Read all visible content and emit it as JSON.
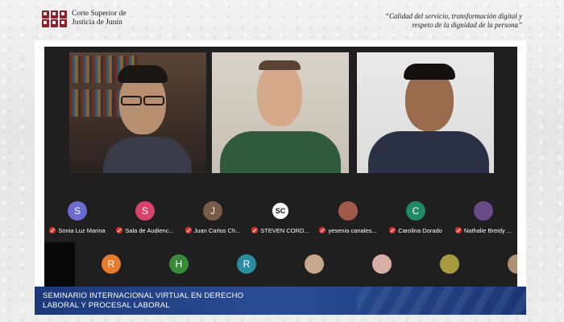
{
  "header": {
    "org_line1": "Corte Superior de",
    "org_line2": "Justicia de Junín",
    "motto_line1": "“Calidad del servicio, transformación digital y",
    "motto_line2": "respeto de la dignidad de la persona”"
  },
  "participants": [
    {
      "initial": "S",
      "name": "Sonia Luz Marina",
      "color": "#6b6bd1"
    },
    {
      "initial": "S",
      "name": "Sala de Audienc...",
      "color": "#d9436b"
    },
    {
      "initial": "J",
      "name": "Juan Carlos Ch...",
      "color": "#7a5a48"
    },
    {
      "initial": "",
      "name": "STEVEN CORD...",
      "color": "#ffffff"
    },
    {
      "initial": "",
      "name": "yesenia canales...",
      "color": "#a05a4a"
    },
    {
      "initial": "C",
      "name": "Carolina Dorado",
      "color": "#1f8a64"
    },
    {
      "initial": "",
      "name": "Nathalie Breidy ...",
      "color": "#6a4b8a"
    }
  ],
  "participants_row2": [
    {
      "initial": "R",
      "color": "#e67b2a"
    },
    {
      "initial": "H",
      "color": "#3a8a3a"
    },
    {
      "initial": "R",
      "color": "#2a8ea0"
    },
    {
      "initial": "",
      "color": "#c9a98a"
    },
    {
      "initial": "",
      "color": "#d8b0a8"
    },
    {
      "initial": "",
      "color": "#a89a40"
    },
    {
      "initial": "",
      "color": "#b09070"
    }
  ],
  "banner": {
    "line1": "SEMINARIO INTERNACIONAL VIRTUAL EN DERECHO",
    "line2": "LABORAL Y PROCESAL LABORAL"
  }
}
